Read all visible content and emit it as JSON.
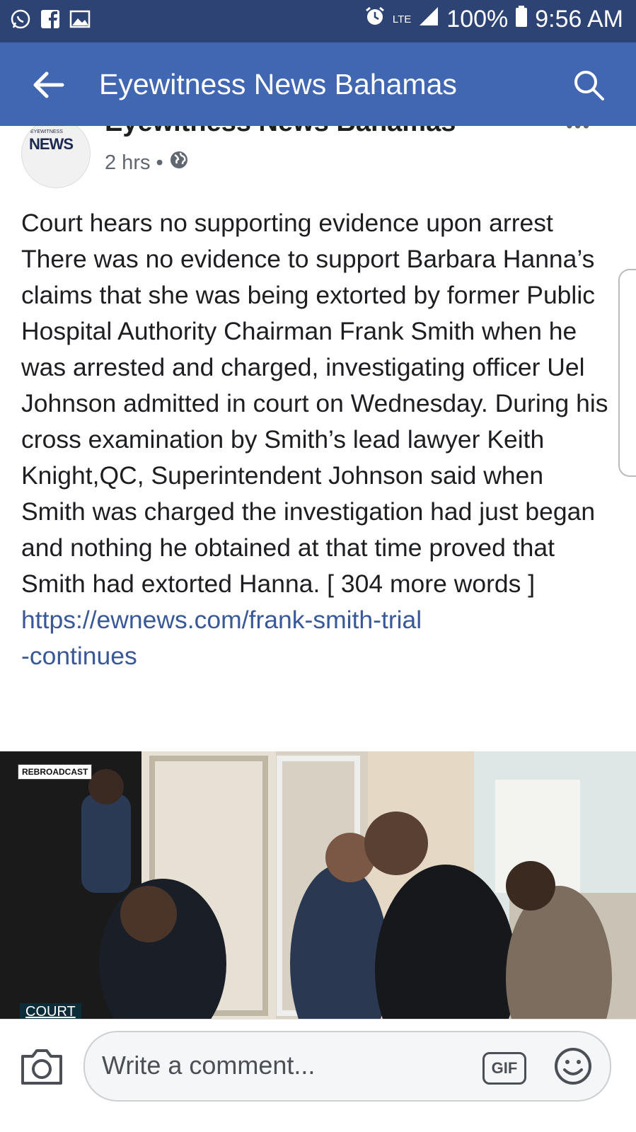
{
  "status_bar": {
    "network": "LTE",
    "battery": "100%",
    "time": "9:56 AM",
    "left_icons": [
      "whatsapp-icon",
      "facebook-icon",
      "gallery-icon"
    ],
    "right_icons": [
      "alarm-icon",
      "signal-icon",
      "battery-icon"
    ]
  },
  "app_bar": {
    "title": "Eyewitness News Bahamas"
  },
  "post": {
    "page_name": "Eyewitness News Bahamas",
    "avatar_label": "NEWS",
    "avatar_small": "EYEWITNESS",
    "time_ago": "2 hrs",
    "separator": "•",
    "body": "Court hears no supporting evidence upon arrest There was no evidence to support Barbara Hanna’s claims that she was being extorted by former Public Hospital Authority Chairman Frank Smith when he was arrested and charged, investigating officer Uel Johnson admitted in court on Wednesday. During his cross examination by Smith’s lead lawyer Keith Knight,QC,  Superintendent Johnson said when Smith was charged the investigation had just began and nothing he obtained at that time proved that Smith had extorted Hanna. [ 304 more words ]",
    "link_line1": "https://ewnews.com/frank-smith-trial",
    "link_line2": "-continues"
  },
  "video": {
    "badge": "REBROADCAST",
    "tag": "COURT"
  },
  "comment_bar": {
    "placeholder": "Write a comment...",
    "gif_label": "GIF"
  },
  "colors": {
    "status_bar": "#2d4373",
    "app_bar": "#4267b2",
    "link": "#385898"
  }
}
